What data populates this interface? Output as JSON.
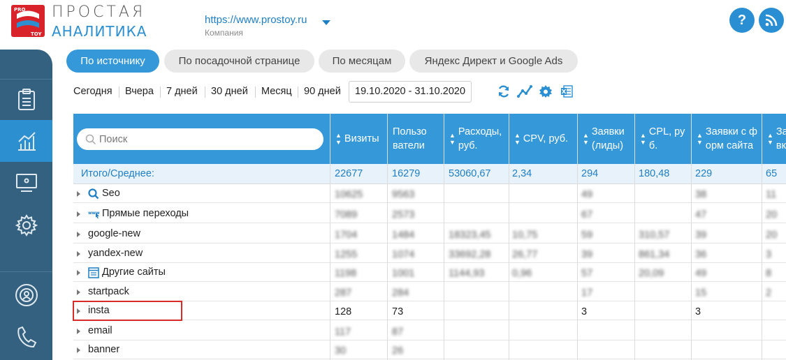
{
  "header": {
    "logo_top": "PRO",
    "logo_bottom": "TOY",
    "brand_line1": "ПРОСТАЯ",
    "brand_line2": "АНАЛИТИКА",
    "site_url": "https://www.prostoy.ru",
    "site_sub": "Компания",
    "help_label": "?",
    "accent_color": "#3598d9"
  },
  "sidebar": {
    "items": [
      {
        "icon": "clipboard-icon"
      },
      {
        "icon": "chart-icon",
        "active": true
      },
      {
        "icon": "monitor-icon"
      },
      {
        "icon": "gear-icon"
      },
      {
        "icon": "target-user-icon"
      },
      {
        "icon": "phone-icon"
      }
    ]
  },
  "tabs": [
    {
      "label": "По источнику",
      "active": true
    },
    {
      "label": "По посадочной странице"
    },
    {
      "label": "По месяцам"
    },
    {
      "label": "Яндекс Директ и Google Ads"
    }
  ],
  "periods": [
    "Сегодня",
    "Вчера",
    "7 дней",
    "30 дней",
    "Месяц",
    "90 дней"
  ],
  "date_range": "19.10.2020 - 31.10.2020",
  "tools": [
    "refresh-icon",
    "trend-icon",
    "settings-icon",
    "excel-icon"
  ],
  "table": {
    "search_placeholder": "Поиск",
    "columns": [
      {
        "line1": "Визиты",
        "line2": ""
      },
      {
        "line1": "Пользо",
        "line2": "ватели"
      },
      {
        "line1": "Расходы,",
        "line2": "руб."
      },
      {
        "line1": "CPV, руб.",
        "line2": ""
      },
      {
        "line1": "Заявки",
        "line2": "(лиды)"
      },
      {
        "line1": "CPL, ру",
        "line2": "б."
      },
      {
        "line1": "Заявки с ф",
        "line2": "орм сайта"
      },
      {
        "line1": "За",
        "line2": "вка"
      }
    ],
    "total": {
      "label": "Итого/Среднее:",
      "values": [
        "22677",
        "16279",
        "53060,67",
        "2,34",
        "294",
        "180,48",
        "229",
        "65"
      ]
    },
    "rows": [
      {
        "name": "Seo",
        "icon": "search-icon",
        "values": [
          "10625",
          "9563",
          "",
          "",
          "49",
          "",
          "38",
          "11"
        ],
        "blurred": true
      },
      {
        "name": "Прямые переходы",
        "icon": "www-icon",
        "values": [
          "7089",
          "2573",
          "",
          "",
          "67",
          "",
          "47",
          "20"
        ],
        "blurred": true
      },
      {
        "name": "google-new",
        "values": [
          "1704",
          "1484",
          "18323,45",
          "10,75",
          "59",
          "310,57",
          "39",
          "20"
        ],
        "blurred": true
      },
      {
        "name": "yandex-new",
        "values": [
          "1255",
          "1074",
          "33692,28",
          "26,77",
          "39",
          "861,34",
          "36",
          "3"
        ],
        "blurred": true
      },
      {
        "name": "Другие сайты",
        "icon": "site-icon",
        "values": [
          "1198",
          "1001",
          "1144,93",
          "0,96",
          "57",
          "20,09",
          "49",
          "8"
        ],
        "blurred": true
      },
      {
        "name": "startpack",
        "values": [
          "287",
          "284",
          "",
          "",
          "17",
          "",
          "15",
          "2"
        ],
        "blurred": true
      },
      {
        "name": "insta",
        "values": [
          "128",
          "73",
          "",
          "",
          "3",
          "",
          "3",
          ""
        ],
        "blurred": false
      },
      {
        "name": "email",
        "values": [
          "117",
          "87",
          "",
          "",
          "",
          "",
          "",
          ""
        ],
        "blurred": true
      },
      {
        "name": "banner",
        "values": [
          "30",
          "26",
          "",
          "",
          "",
          "",
          "",
          ""
        ],
        "blurred": true
      }
    ]
  }
}
